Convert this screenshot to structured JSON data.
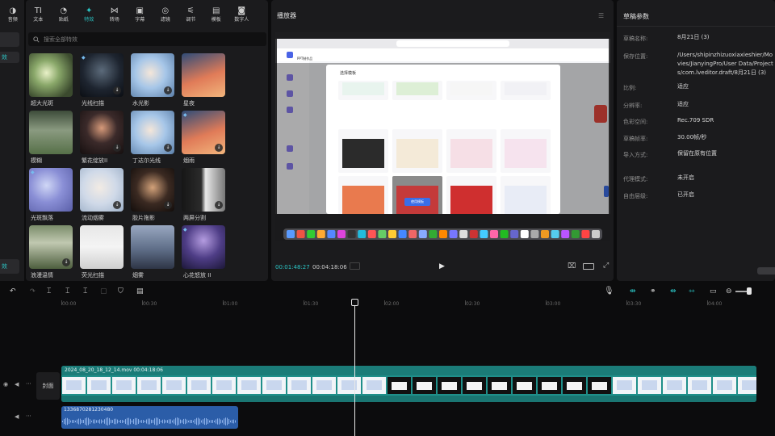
{
  "left_strip": {
    "item1": "",
    "item2": "效",
    "item3": "效"
  },
  "toolbar": [
    {
      "icon": "music-icon",
      "glyph": "◑",
      "label": "音频"
    },
    {
      "icon": "text-icon",
      "glyph": "TI",
      "label": "文本"
    },
    {
      "icon": "sticker-icon",
      "glyph": "◔",
      "label": "贴纸"
    },
    {
      "icon": "effects-icon",
      "glyph": "✦",
      "label": "特效"
    },
    {
      "icon": "transition-icon",
      "glyph": "⋈",
      "label": "转场"
    },
    {
      "icon": "caption-icon",
      "glyph": "▣",
      "label": "字幕"
    },
    {
      "icon": "filter-icon",
      "glyph": "◎",
      "label": "滤镜"
    },
    {
      "icon": "adjust-icon",
      "glyph": "⚟",
      "label": "调节"
    },
    {
      "icon": "template-icon",
      "glyph": "▤",
      "label": "模板"
    },
    {
      "icon": "digital-human-icon",
      "glyph": "◙",
      "label": "数字人"
    }
  ],
  "search": {
    "placeholder": "搜索全部特效"
  },
  "effects": [
    {
      "label": "超大光斑",
      "gem": false,
      "dl": false
    },
    {
      "label": "光线扫描",
      "gem": true,
      "dl": true
    },
    {
      "label": "水光影",
      "gem": false,
      "dl": true
    },
    {
      "label": "星夜",
      "gem": false,
      "dl": false
    },
    {
      "label": "模糊",
      "gem": false,
      "dl": false
    },
    {
      "label": "繁花绽放II",
      "gem": false,
      "dl": true
    },
    {
      "label": "丁达尔光线",
      "gem": false,
      "dl": true
    },
    {
      "label": "烟雨",
      "gem": true,
      "dl": true
    },
    {
      "label": "光斑飘落",
      "gem": true,
      "dl": false
    },
    {
      "label": "流动烟雾",
      "gem": false,
      "dl": true
    },
    {
      "label": "胶片拖影",
      "gem": false,
      "dl": true
    },
    {
      "label": "两屏分割",
      "gem": false,
      "dl": true
    },
    {
      "label": "浪漫温情",
      "gem": false,
      "dl": true
    },
    {
      "label": "荧光扫描",
      "gem": false,
      "dl": false
    },
    {
      "label": "烟雾",
      "gem": false,
      "dl": false
    },
    {
      "label": "心花怒放 II",
      "gem": true,
      "dl": false
    }
  ],
  "player": {
    "title": "播放器",
    "current_time": "00:01:48:27",
    "total_time": "00:04:18:06"
  },
  "screen": {
    "page_title": "PPT制作品",
    "modal_title": "选择模板",
    "button": "使用模板"
  },
  "params": {
    "title": "草稿参数",
    "rows": [
      {
        "key": "草稿名称:",
        "value": "8月21日 (3)"
      },
      {
        "key": "保存位置:",
        "value": "/Users/shipinzhizuoxiaxieshier/Movies/JianyingPro/User Data/Projects/com.lveditor.draft/8月21日 (3)"
      },
      {
        "key": "比例:",
        "value": "适应"
      },
      {
        "key": "分辨率:",
        "value": "适应"
      },
      {
        "key": "色彩空间:",
        "value": "Rec.709 SDR"
      },
      {
        "key": "草稿帧率:",
        "value": "30.00帧/秒"
      },
      {
        "key": "导入方式:",
        "value": "保留在原有位置"
      },
      {
        "key": "代理模式:",
        "value": "未开启"
      },
      {
        "key": "自由层级:",
        "value": "已开启"
      }
    ]
  },
  "ruler": [
    "00:00",
    "00:30",
    "01:00",
    "01:30",
    "02:00",
    "02:30",
    "03:00",
    "03:30",
    "04:00"
  ],
  "tracks": {
    "cover_label": "封面",
    "video_clip": "2024_08_20_18_12_14.mov   00:04:18:06",
    "audio_clip": "13368702812304​80"
  },
  "colors": {
    "accent": "#2bc6c6",
    "video_track": "#1f8f8a",
    "audio_track": "#2b5da8"
  }
}
